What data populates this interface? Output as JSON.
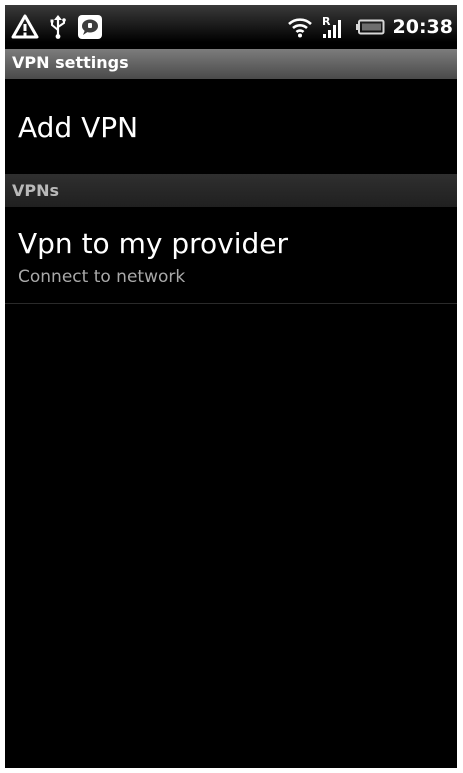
{
  "status_bar": {
    "time": "20:38",
    "roaming_indicator": "R",
    "icons": [
      "warning-icon",
      "usb-icon",
      "chat-notification-icon",
      "wifi-icon",
      "signal-icon",
      "battery-icon"
    ]
  },
  "title_bar": {
    "title": "VPN settings"
  },
  "add_vpn": {
    "label": "Add VPN"
  },
  "vpns_section": {
    "header": "VPNs",
    "items": [
      {
        "title": "Vpn to my provider",
        "summary": "Connect to network"
      }
    ]
  }
}
